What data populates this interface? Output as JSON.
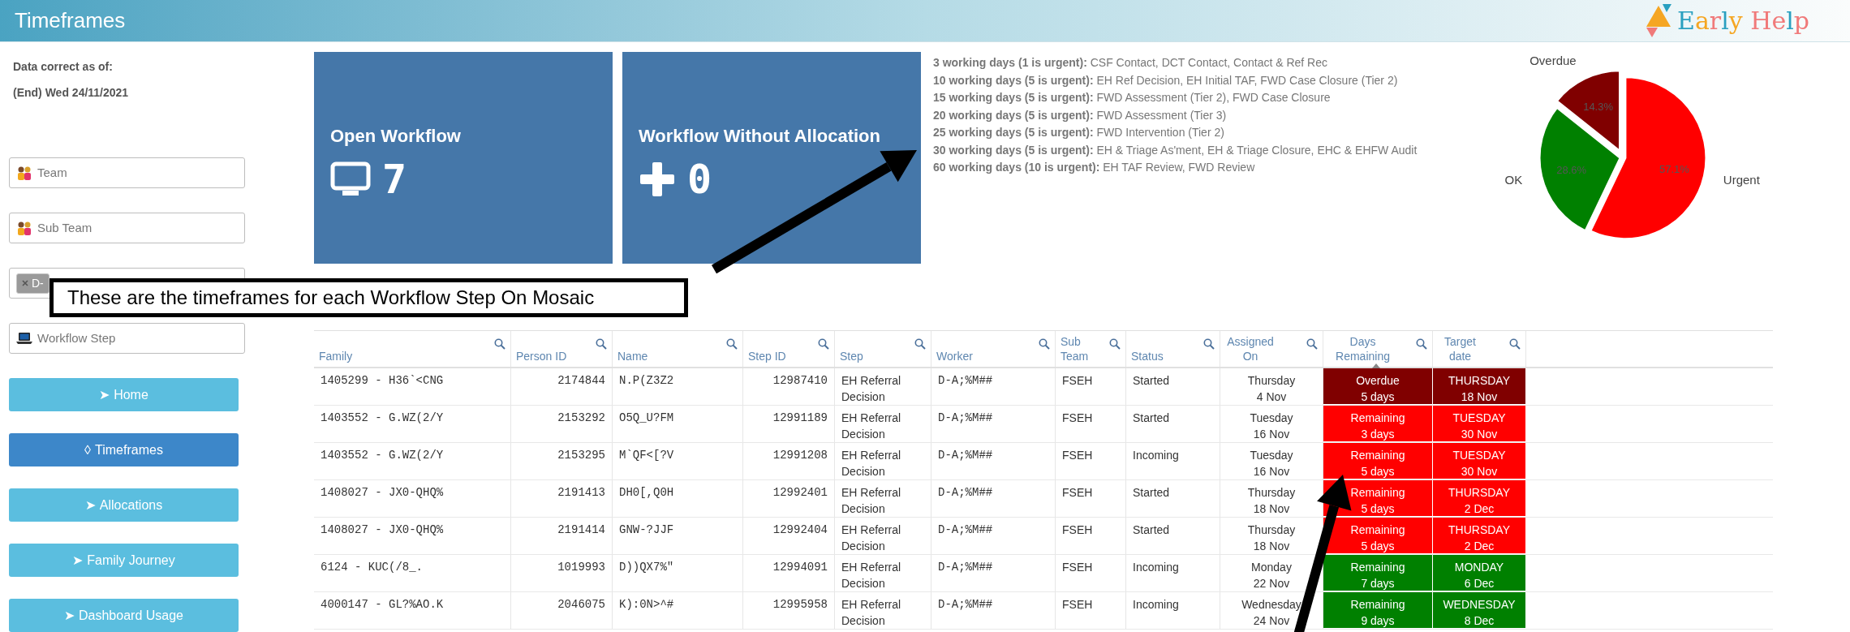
{
  "header": {
    "title": "Timeframes",
    "logo_text": "Early Help"
  },
  "sidebar": {
    "data_note": [
      "Data correct as of:",
      "(End) Wed 24/11/2021"
    ],
    "filters": [
      {
        "kind": "group",
        "label": "Team"
      },
      {
        "kind": "group",
        "label": "Sub Team"
      },
      {
        "kind": "chip",
        "label": "D-"
      },
      {
        "kind": "device",
        "label": "Workflow Step"
      }
    ],
    "nav": [
      {
        "icon": "➤",
        "label": "Home",
        "selected": false
      },
      {
        "icon": "◊",
        "label": "Timeframes",
        "selected": true
      },
      {
        "icon": "➤",
        "label": "Allocations",
        "selected": false
      },
      {
        "icon": "➤",
        "label": "Family Journey",
        "selected": false
      },
      {
        "icon": "➤",
        "label": "Dashboard Usage",
        "selected": false
      }
    ]
  },
  "tiles": [
    {
      "kind": "monitor",
      "title": "Open Workflow",
      "value": "7"
    },
    {
      "kind": "plus",
      "title": "Workflow Without Allocation",
      "value": "0"
    }
  ],
  "timeframes": [
    "**3 working days (1 is urgent):** CSF Contact, DCT Contact, Contact & Ref Rec",
    "**10 working days (5 is urgent):** EH Ref Decision, EH Initial TAF, FWD Case Closure (Tier 2)",
    "**15 working days (5 is urgent):** FWD Assessment (Tier 2), FWD Case Closure",
    "**20 working days (5 is urgent):** FWD Assessment (Tier 3)",
    "**25 working days (5 is urgent):** FWD Intervention (Tier 2)",
    "**30 working days (5 is urgent):** EH & Triage As'ment, EH & Triage Closure, EHC & EHFW Audit",
    "**60 working days (10 is urgent):** EH TAF Review, FWD Review"
  ],
  "pie": {
    "chart_data": {
      "type": "pie",
      "categories": [
        "Overdue",
        "OK",
        "Urgent"
      ],
      "values": [
        14.3,
        28.6,
        57.1
      ],
      "colors": [
        "#800000",
        "#008000",
        "#ff0000"
      ],
      "value_labels": [
        "14.3%",
        "28.6%",
        "57.1%"
      ]
    }
  },
  "annotations": [
    {
      "text": "These are the timeframes for each Workflow Step On Mosaic"
    }
  ],
  "table": {
    "columns": [
      {
        "label": "Family",
        "sorted": false
      },
      {
        "label": "Person ID",
        "sorted": false
      },
      {
        "label": "Name",
        "sorted": false
      },
      {
        "label": "Step ID",
        "sorted": false
      },
      {
        "label": "Step",
        "sorted": false
      },
      {
        "label": "Worker",
        "sorted": false
      },
      {
        "label": "Sub Team",
        "sorted": false
      },
      {
        "label": "Status",
        "sorted": false
      },
      {
        "label": "Assigned On",
        "sorted": false
      },
      {
        "label": "Days Remaining",
        "sorted": true
      },
      {
        "label": "Target date",
        "sorted": false
      }
    ],
    "rows": [
      {
        "family": "1405299 - H36`<CNG",
        "person_id": "2174844",
        "name": "N.P(Z3Z2",
        "step_id": "12987410",
        "step": "EH Referral Decision",
        "worker": "D-A;%M##",
        "sub_team": "FSEH",
        "status": "Started",
        "assigned_day": "Thursday",
        "assigned_date": "4 Nov",
        "days_label": "Overdue",
        "days": "5 days",
        "target_day": "THURSDAY",
        "target_date": "18 Nov",
        "color": "#800000"
      },
      {
        "family": "1403552 - G.WZ(2/Y",
        "person_id": "2153292",
        "name": "O5Q_U?FM",
        "step_id": "12991189",
        "step": "EH Referral Decision",
        "worker": "D-A;%M##",
        "sub_team": "FSEH",
        "status": "Started",
        "assigned_day": "Tuesday",
        "assigned_date": "16 Nov",
        "days_label": "Remaining",
        "days": "3 days",
        "target_day": "TUESDAY",
        "target_date": "30 Nov",
        "color": "#ff0000"
      },
      {
        "family": "1403552 - G.WZ(2/Y",
        "person_id": "2153295",
        "name": "M`QF<[?V",
        "step_id": "12991208",
        "step": "EH Referral Decision",
        "worker": "D-A;%M##",
        "sub_team": "FSEH",
        "status": "Incoming",
        "assigned_day": "Tuesday",
        "assigned_date": "16 Nov",
        "days_label": "Remaining",
        "days": "5 days",
        "target_day": "TUESDAY",
        "target_date": "30 Nov",
        "color": "#ff0000"
      },
      {
        "family": "1408027 - JX0-QHQ%",
        "person_id": "2191413",
        "name": "DH0[,Q0H",
        "step_id": "12992401",
        "step": "EH Referral Decision",
        "worker": "D-A;%M##",
        "sub_team": "FSEH",
        "status": "Started",
        "assigned_day": "Thursday",
        "assigned_date": "18 Nov",
        "days_label": "Remaining",
        "days": "5 days",
        "target_day": "THURSDAY",
        "target_date": "2 Dec",
        "color": "#ff0000"
      },
      {
        "family": "1408027 - JX0-QHQ%",
        "person_id": "2191414",
        "name": "GNW-?JJF",
        "step_id": "12992404",
        "step": "EH Referral Decision",
        "worker": "D-A;%M##",
        "sub_team": "FSEH",
        "status": "Started",
        "assigned_day": "Thursday",
        "assigned_date": "18 Nov",
        "days_label": "Remaining",
        "days": "5 days",
        "target_day": "THURSDAY",
        "target_date": "2 Dec",
        "color": "#ff0000"
      },
      {
        "family": "6124 - KUC(/8_.",
        "person_id": "1019993",
        "name": "D))QX7%\"",
        "step_id": "12994091",
        "step": "EH Referral Decision",
        "worker": "D-A;%M##",
        "sub_team": "FSEH",
        "status": "Incoming",
        "assigned_day": "Monday",
        "assigned_date": "22 Nov",
        "days_label": "Remaining",
        "days": "7 days",
        "target_day": "MONDAY",
        "target_date": "6 Dec",
        "color": "#008000"
      },
      {
        "family": "4000147 - GL?%AO.K",
        "person_id": "2046075",
        "name": "K):0N>^#",
        "step_id": "12995958",
        "step": "EH Referral Decision",
        "worker": "D-A;%M##",
        "sub_team": "FSEH",
        "status": "Incoming",
        "assigned_day": "Wednesday",
        "assigned_date": "24 Nov",
        "days_label": "Remaining",
        "days": "9 days",
        "target_day": "WEDNESDAY",
        "target_date": "8 Dec",
        "color": "#008000"
      }
    ]
  }
}
